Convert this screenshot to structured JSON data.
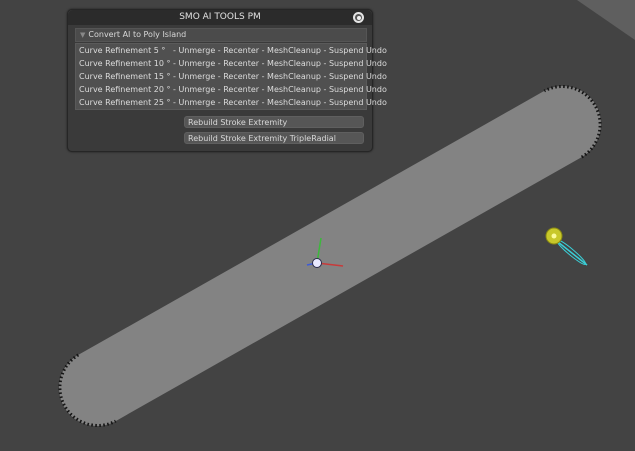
{
  "panel": {
    "title": "SMO AI TOOLS PM",
    "section_label": "Convert AI to Poly Island",
    "curve_buttons": [
      "Curve Refinement 5 °   - Unmerge - Recenter - MeshCleanup - Suspend Undo",
      "Curve Refinement 10 ° - Unmerge - Recenter - MeshCleanup - Suspend Undo",
      "Curve Refinement 15 ° - Unmerge - Recenter - MeshCleanup - Suspend Undo",
      "Curve Refinement 20 ° - Unmerge - Recenter - MeshCleanup - Suspend Undo",
      "Curve Refinement 25 ° - Unmerge - Recenter - MeshCleanup - Suspend Undo"
    ],
    "rebuild_extremity_label": "Rebuild Stroke Extremity",
    "rebuild_triple_radial_label": "Rebuild Stroke Extremity TripleRadial"
  },
  "icons": {
    "close": "radio-close-icon",
    "section_collapse": "triangle-down-icon",
    "gizmo": "transform-gizmo-icon",
    "light": "light-icon"
  },
  "colors": {
    "viewport_bg": "#434343",
    "mesh": "#838383",
    "gizmo_x": "#c83a3a",
    "gizmo_y": "#3cb83c",
    "gizmo_z": "#3d5bd8",
    "light": "#c8c82a",
    "light_beam": "#3ad0d8"
  }
}
